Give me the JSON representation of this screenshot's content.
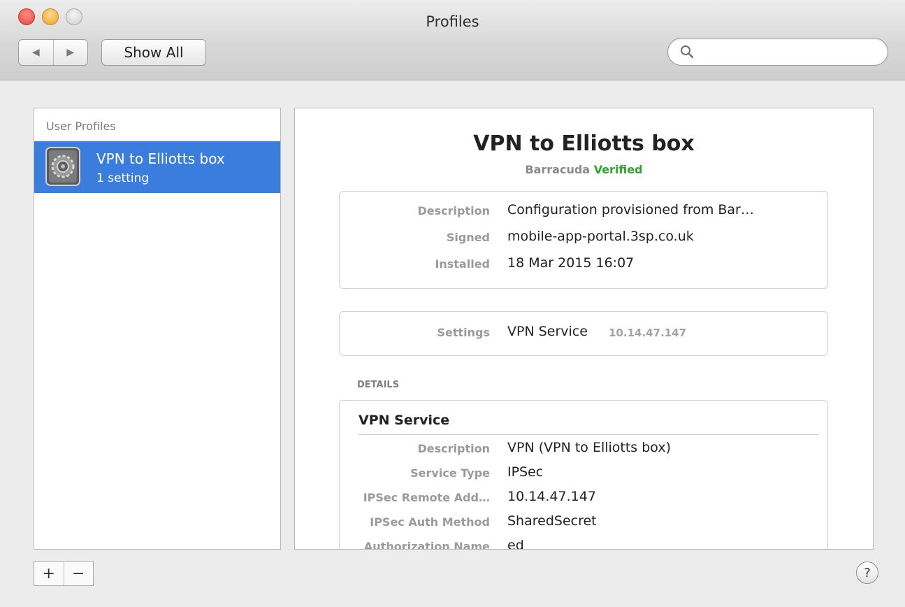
{
  "window": {
    "title": "Profiles"
  },
  "toolbar": {
    "back_glyph": "◀",
    "forward_glyph": "▶",
    "show_all_label": "Show All",
    "search_placeholder": "",
    "search_value": ""
  },
  "sidebar": {
    "header": "User Profiles",
    "items": [
      {
        "name": "VPN to Elliotts box",
        "subtitle": "1 setting",
        "icon": "system-preferences-gear-icon",
        "selected": true
      }
    ],
    "add_label": "+",
    "remove_label": "−"
  },
  "detail": {
    "title": "VPN to Elliotts box",
    "organization": "Barracuda",
    "verified_label": "Verified",
    "summary": [
      {
        "label": "Description",
        "value": "Configuration provisioned from Bar…"
      },
      {
        "label": "Signed",
        "value": "mobile-app-portal.3sp.co.uk"
      },
      {
        "label": "Installed",
        "value": "18 Mar 2015 16:07"
      }
    ],
    "settings": {
      "label": "Settings",
      "value": "VPN Service",
      "extra": "10.14.47.147"
    },
    "details_header": "DETAILS",
    "service": {
      "title": "VPN Service",
      "rows": [
        {
          "label": "Description",
          "value": "VPN (VPN to Elliotts box)"
        },
        {
          "label": "Service Type",
          "value": "IPSec"
        },
        {
          "label": "IPSec Remote Add…",
          "value": "10.14.47.147"
        },
        {
          "label": "IPSec Auth Method",
          "value": "SharedSecret"
        },
        {
          "label": "Authorization Name",
          "value": "ed"
        }
      ]
    }
  },
  "help_label": "?",
  "colors": {
    "selection": "#3b7ddd",
    "verified": "#2fa52f"
  }
}
